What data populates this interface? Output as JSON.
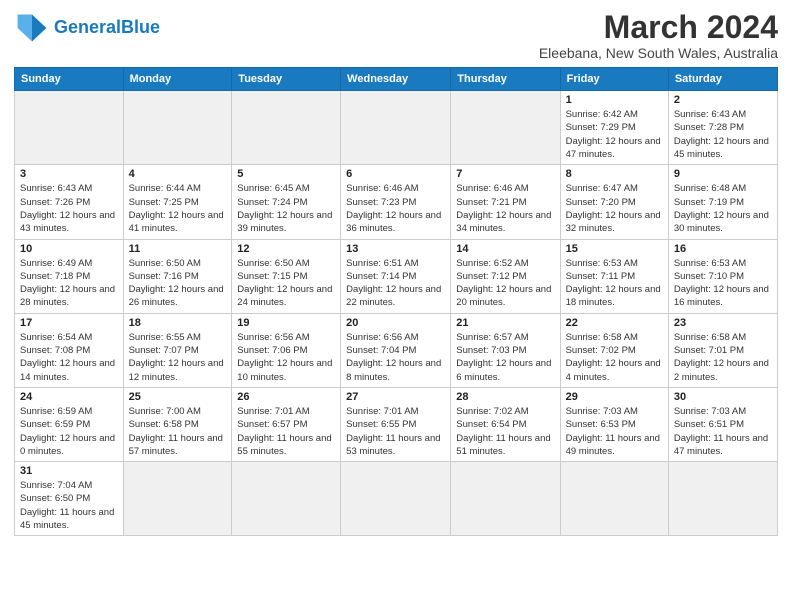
{
  "header": {
    "logo_general": "General",
    "logo_blue": "Blue",
    "month_title": "March 2024",
    "location": "Eleebana, New South Wales, Australia"
  },
  "weekdays": [
    "Sunday",
    "Monday",
    "Tuesday",
    "Wednesday",
    "Thursday",
    "Friday",
    "Saturday"
  ],
  "weeks": [
    [
      {
        "day": "",
        "info": ""
      },
      {
        "day": "",
        "info": ""
      },
      {
        "day": "",
        "info": ""
      },
      {
        "day": "",
        "info": ""
      },
      {
        "day": "",
        "info": ""
      },
      {
        "day": "1",
        "info": "Sunrise: 6:42 AM\nSunset: 7:29 PM\nDaylight: 12 hours and 47 minutes."
      },
      {
        "day": "2",
        "info": "Sunrise: 6:43 AM\nSunset: 7:28 PM\nDaylight: 12 hours and 45 minutes."
      }
    ],
    [
      {
        "day": "3",
        "info": "Sunrise: 6:43 AM\nSunset: 7:26 PM\nDaylight: 12 hours and 43 minutes."
      },
      {
        "day": "4",
        "info": "Sunrise: 6:44 AM\nSunset: 7:25 PM\nDaylight: 12 hours and 41 minutes."
      },
      {
        "day": "5",
        "info": "Sunrise: 6:45 AM\nSunset: 7:24 PM\nDaylight: 12 hours and 39 minutes."
      },
      {
        "day": "6",
        "info": "Sunrise: 6:46 AM\nSunset: 7:23 PM\nDaylight: 12 hours and 36 minutes."
      },
      {
        "day": "7",
        "info": "Sunrise: 6:46 AM\nSunset: 7:21 PM\nDaylight: 12 hours and 34 minutes."
      },
      {
        "day": "8",
        "info": "Sunrise: 6:47 AM\nSunset: 7:20 PM\nDaylight: 12 hours and 32 minutes."
      },
      {
        "day": "9",
        "info": "Sunrise: 6:48 AM\nSunset: 7:19 PM\nDaylight: 12 hours and 30 minutes."
      }
    ],
    [
      {
        "day": "10",
        "info": "Sunrise: 6:49 AM\nSunset: 7:18 PM\nDaylight: 12 hours and 28 minutes."
      },
      {
        "day": "11",
        "info": "Sunrise: 6:50 AM\nSunset: 7:16 PM\nDaylight: 12 hours and 26 minutes."
      },
      {
        "day": "12",
        "info": "Sunrise: 6:50 AM\nSunset: 7:15 PM\nDaylight: 12 hours and 24 minutes."
      },
      {
        "day": "13",
        "info": "Sunrise: 6:51 AM\nSunset: 7:14 PM\nDaylight: 12 hours and 22 minutes."
      },
      {
        "day": "14",
        "info": "Sunrise: 6:52 AM\nSunset: 7:12 PM\nDaylight: 12 hours and 20 minutes."
      },
      {
        "day": "15",
        "info": "Sunrise: 6:53 AM\nSunset: 7:11 PM\nDaylight: 12 hours and 18 minutes."
      },
      {
        "day": "16",
        "info": "Sunrise: 6:53 AM\nSunset: 7:10 PM\nDaylight: 12 hours and 16 minutes."
      }
    ],
    [
      {
        "day": "17",
        "info": "Sunrise: 6:54 AM\nSunset: 7:08 PM\nDaylight: 12 hours and 14 minutes."
      },
      {
        "day": "18",
        "info": "Sunrise: 6:55 AM\nSunset: 7:07 PM\nDaylight: 12 hours and 12 minutes."
      },
      {
        "day": "19",
        "info": "Sunrise: 6:56 AM\nSunset: 7:06 PM\nDaylight: 12 hours and 10 minutes."
      },
      {
        "day": "20",
        "info": "Sunrise: 6:56 AM\nSunset: 7:04 PM\nDaylight: 12 hours and 8 minutes."
      },
      {
        "day": "21",
        "info": "Sunrise: 6:57 AM\nSunset: 7:03 PM\nDaylight: 12 hours and 6 minutes."
      },
      {
        "day": "22",
        "info": "Sunrise: 6:58 AM\nSunset: 7:02 PM\nDaylight: 12 hours and 4 minutes."
      },
      {
        "day": "23",
        "info": "Sunrise: 6:58 AM\nSunset: 7:01 PM\nDaylight: 12 hours and 2 minutes."
      }
    ],
    [
      {
        "day": "24",
        "info": "Sunrise: 6:59 AM\nSunset: 6:59 PM\nDaylight: 12 hours and 0 minutes."
      },
      {
        "day": "25",
        "info": "Sunrise: 7:00 AM\nSunset: 6:58 PM\nDaylight: 11 hours and 57 minutes."
      },
      {
        "day": "26",
        "info": "Sunrise: 7:01 AM\nSunset: 6:57 PM\nDaylight: 11 hours and 55 minutes."
      },
      {
        "day": "27",
        "info": "Sunrise: 7:01 AM\nSunset: 6:55 PM\nDaylight: 11 hours and 53 minutes."
      },
      {
        "day": "28",
        "info": "Sunrise: 7:02 AM\nSunset: 6:54 PM\nDaylight: 11 hours and 51 minutes."
      },
      {
        "day": "29",
        "info": "Sunrise: 7:03 AM\nSunset: 6:53 PM\nDaylight: 11 hours and 49 minutes."
      },
      {
        "day": "30",
        "info": "Sunrise: 7:03 AM\nSunset: 6:51 PM\nDaylight: 11 hours and 47 minutes."
      }
    ],
    [
      {
        "day": "31",
        "info": "Sunrise: 7:04 AM\nSunset: 6:50 PM\nDaylight: 11 hours and 45 minutes."
      },
      {
        "day": "",
        "info": ""
      },
      {
        "day": "",
        "info": ""
      },
      {
        "day": "",
        "info": ""
      },
      {
        "day": "",
        "info": ""
      },
      {
        "day": "",
        "info": ""
      },
      {
        "day": "",
        "info": ""
      }
    ]
  ]
}
